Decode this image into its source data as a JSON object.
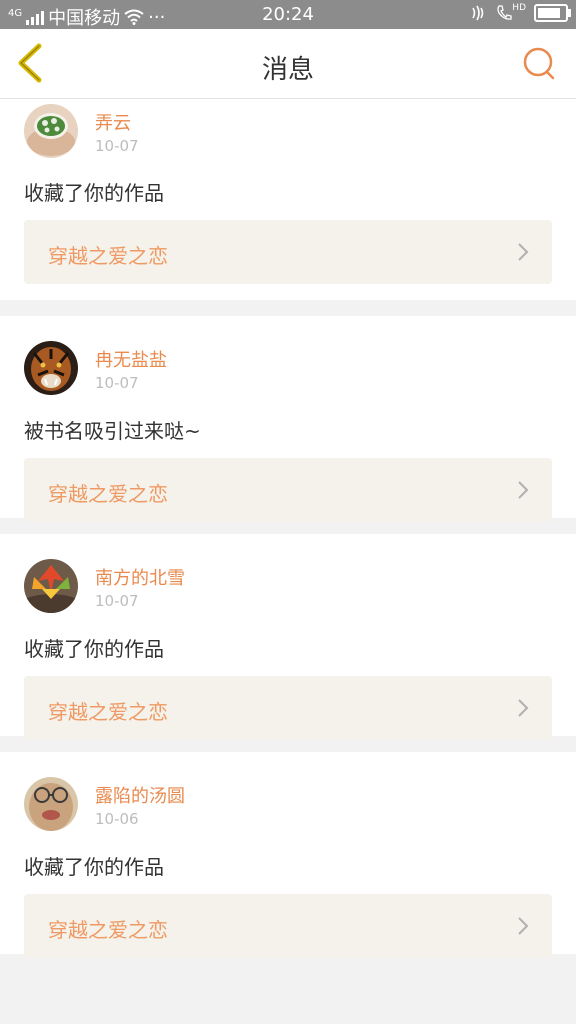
{
  "status_bar": {
    "network": "4G",
    "carrier": "中国移动",
    "dots": "···",
    "time": "20:24",
    "hd": "HD",
    "battery_level": 0.85
  },
  "header": {
    "title": "消息"
  },
  "messages": [
    {
      "user": "弄云",
      "date": "10-07",
      "text": "收藏了你的作品",
      "work": "穿越之爱之恋"
    },
    {
      "user": "冉无盐盐",
      "date": "10-07",
      "text": "被书名吸引过来哒~",
      "work": "穿越之爱之恋"
    },
    {
      "user": "南方的北雪",
      "date": "10-07",
      "text": "收藏了你的作品",
      "work": "穿越之爱之恋"
    },
    {
      "user": "露陷的汤圆",
      "date": "10-06",
      "text": "收藏了你的作品",
      "work": "穿越之爱之恋"
    }
  ],
  "colors": {
    "accent_orange": "#e98a4e",
    "back_icon": "#d9b800",
    "work_bg": "#f4f2ea"
  }
}
